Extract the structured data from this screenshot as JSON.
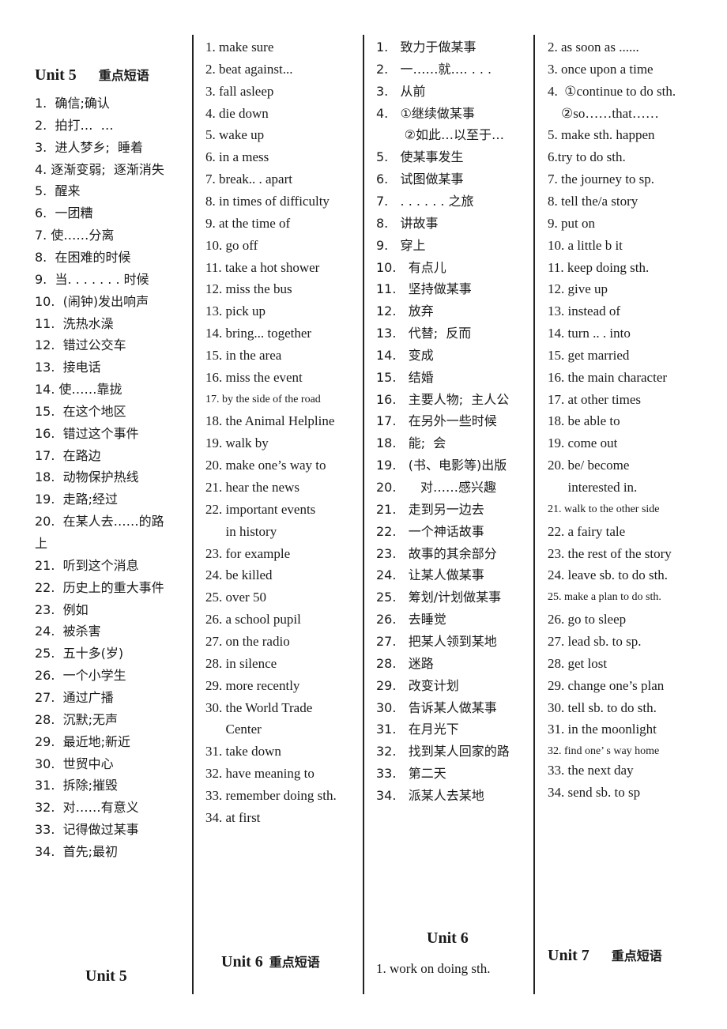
{
  "col1": {
    "header": {
      "unit": "Unit 5",
      "title": "重点短语"
    },
    "items": [
      "1.  确信;确认",
      "2.  拍打…  …",
      "3.  进人梦乡;  睡着",
      "4. 逐渐变弱;  逐渐消失",
      "5.  醒来",
      "6.  一团糟",
      "7. 使……分离",
      "8.  在困难的时候",
      "9.  当. . . . . . . 时候",
      "10.  (闹钟)发出响声",
      "11.  洗热水澡",
      "12.  错过公交车",
      "13.  接电话",
      "14. 使……靠拢",
      "15.  在这个地区",
      "16.  错过这个事件",
      "17.  在路边",
      "18.  动物保护热线",
      "19.  走路;经过",
      "20.  在某人去……的路",
      "上",
      "21.  听到这个消息",
      "22.  历史上的重大事件",
      "23.  例如",
      "24.  被杀害",
      "25.  五十多(岁)",
      "26.  一个小学生",
      "27.  通过广播",
      "28.  沉默;无声",
      "29.  最近地;新近",
      "30.  世贸中心",
      "31.  拆除;摧毁",
      "32.  对……有意义",
      "33.  记得做过某事",
      "34.  首先;最初"
    ],
    "footer": "Unit 5"
  },
  "col2": {
    "items": [
      "1. make sure",
      "2. beat against...",
      "3. fall asleep",
      "4. die down",
      "5. wake up",
      "6. in a mess",
      "7. break.. . apart",
      "8. in times of difficulty",
      "9. at the time of",
      "10. go off",
      "11. take a hot shower",
      "12. miss the bus",
      "13. pick up",
      "14. bring... together",
      "15. in the area",
      "16. miss the event",
      "17. by the side of the road",
      "18. the Animal Helpline",
      "19. walk by",
      "20. make one’s way to",
      "21. hear the news",
      "22. important events",
      "      in history",
      "23. for example",
      "24. be killed",
      "25. over 50",
      "26. a school pupil",
      "27. on the radio",
      "28. in silence",
      "29. more recently",
      "30. the World Trade",
      "      Center",
      "31. take down",
      "32. have meaning to",
      "33. remember doing sth.",
      "34. at first"
    ],
    "footer": {
      "unit": "Unit 6",
      "title": "重点短语"
    }
  },
  "col3": {
    "items": [
      "1.   致力于做某事",
      "2.   一……就…. . . .",
      "3.   从前",
      "4.   ①继续做某事",
      "       ②如此…以至于…",
      "5.   使某事发生",
      "6.   试图做某事",
      "7.   . . . . . . 之旅",
      "8.   讲故事",
      "9.   穿上",
      "10.   有点儿",
      "11.   坚持做某事",
      "12.   放弃",
      "13.   代替;  反而",
      "14.   变成",
      "15.   结婚",
      "16.   主要人物;  主人公",
      "17.   在另外一些时候",
      "18.   能;  会",
      "19.   (书、电影等)出版",
      "20.      对……感兴趣",
      "21.   走到另一边去",
      "22.   一个神话故事",
      "23.   故事的其余部分",
      "24.   让某人做某事",
      "25.   筹划/计划做某事",
      "26.   去睡觉",
      "27.   把某人领到某地",
      "28.   迷路",
      "29.   改变计划",
      "30.   告诉某人做某事",
      "31.   在月光下",
      "32.   找到某人回家的路",
      "33.   第二天",
      "34.   派某人去某地"
    ],
    "footer": {
      "unit": "Unit 6",
      "item": "1. work on doing sth."
    }
  },
  "col4": {
    "items": [
      "2. as soon as ......",
      "3. once upon a time",
      "4.  ①continue to do sth.",
      "    ②so……that……",
      "5. make sth. happen",
      "6.try to do sth.",
      "7. the journey to sp.",
      "8. tell the/a story",
      "9. put on",
      "10. a little b it",
      "11. keep doing sth.",
      "12. give up",
      "13. instead of",
      "14. turn .. . into",
      "15. get married",
      "16. the main character",
      "17. at other times",
      "18. be able to",
      "19. come out",
      "20. be/ become",
      "      interested in.",
      "21. walk to the other side",
      "22. a fairy tale",
      "23. the rest of the story",
      "24. leave sb. to do sth.",
      "25. make a plan to do sth.",
      "26. go to sleep",
      "27. lead sb. to sp.",
      "28. get lost",
      "29. change one’s plan",
      "30. tell sb. to do sth.",
      "31. in the moonlight",
      "32. find one’ s way home",
      "33. the next day",
      "34. send sb. to sp"
    ],
    "footer": {
      "unit": "Unit 7",
      "title": "重点短语"
    }
  }
}
